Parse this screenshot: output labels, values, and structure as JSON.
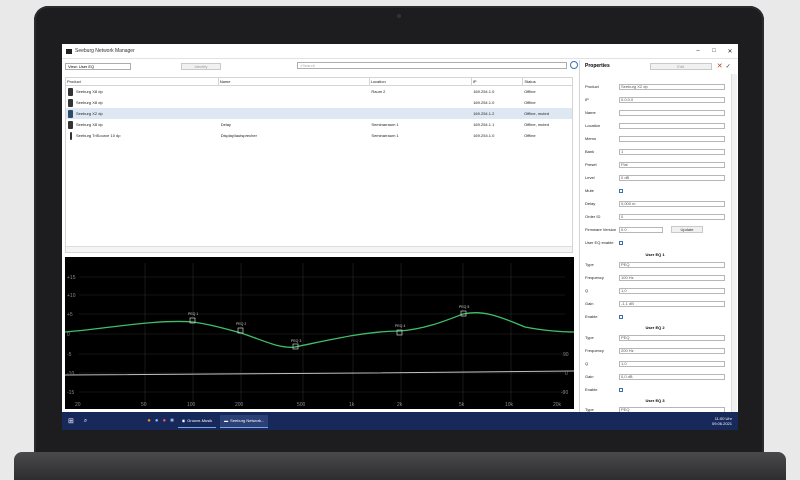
{
  "window": {
    "title": "Seeburg Network Manager",
    "min": "–",
    "max": "□",
    "close": "✕"
  },
  "toolbar": {
    "filter_value": "View: User EQ",
    "identify": "Identify",
    "search_placeholder": "Search"
  },
  "table": {
    "headers": [
      "Product",
      "Name",
      "Location",
      "IP",
      "Status"
    ],
    "rows": [
      {
        "product": "Seeburg X8 dp",
        "name": "",
        "location": "Raum 2",
        "ip": "169.254.1.0",
        "status": "Offline"
      },
      {
        "product": "Seeburg X8 dp",
        "name": "",
        "location": "",
        "ip": "169.254.1.0",
        "status": "Offline"
      },
      {
        "product": "Seeburg X2 dp",
        "name": "",
        "location": "",
        "ip": "169.254.1.2",
        "status": "Offline, muted"
      },
      {
        "product": "Seeburg X8 dp",
        "name": "Delay",
        "location": "Seminarraum 1",
        "ip": "169.254.1.1",
        "status": "Offline, muted"
      },
      {
        "product": "Seeburg TriSource 10 dp",
        "name": "Display/lautsprecher",
        "location": "Seminarraum 1",
        "ip": "169.254.1.0",
        "status": "Offline"
      }
    ]
  },
  "graph": {
    "y_labels": [
      "+15",
      "+10",
      "+5",
      "0",
      "-5",
      "-10",
      "-15"
    ],
    "x_labels": [
      "20",
      "50",
      "100",
      "200",
      "500",
      "1k",
      "2k",
      "5k",
      "10k",
      "20k"
    ],
    "right_labels": [
      "90",
      "0",
      "-90"
    ],
    "points": [
      "PEQ 1",
      "PEQ 2",
      "PEQ 3",
      "PEQ 4",
      "PEQ 5"
    ],
    "colors": {
      "curve": "#3fbf6a",
      "phase": "#bfbfbf",
      "grid": "#2a2a2a"
    }
  },
  "properties": {
    "title": "Properties",
    "edit": "Edit",
    "fields": [
      {
        "label": "Product",
        "value": "Seeburg X2 dp"
      },
      {
        "label": "IP",
        "value": "0.0.0.0"
      },
      {
        "label": "Name",
        "value": ""
      },
      {
        "label": "Location",
        "value": ""
      },
      {
        "label": "Memo",
        "value": ""
      },
      {
        "label": "Bank",
        "value": "1"
      },
      {
        "label": "Preset",
        "value": "Flat"
      },
      {
        "label": "Level",
        "value": "0 dB"
      },
      {
        "label": "Mute",
        "value": ""
      },
      {
        "label": "Delay",
        "value": "0,000 m"
      },
      {
        "label": "Order ID",
        "value": "0"
      },
      {
        "label": "Firmware Version",
        "value": "0.0"
      },
      {
        "label": "User EQ enable",
        "value": ""
      }
    ],
    "update": "Update",
    "eq1": {
      "title": "User EQ 1",
      "type": "PEQ",
      "frequency": "100 Hz",
      "q": "1,0",
      "gain": "-1,1 dB"
    },
    "eq2": {
      "title": "User EQ 2",
      "type": "PEQ",
      "frequency": "200 Hz",
      "q": "1,0",
      "gain": "0,0 dB"
    },
    "eq3": {
      "title": "User EQ 3",
      "type": "PEQ"
    },
    "labels": {
      "type": "Type",
      "frequency": "Frequency",
      "q": "Q",
      "gain": "Gain",
      "enable": "Enable"
    }
  },
  "taskbar": {
    "app1": "Groove-Musik",
    "app2": "Seeburg Network...",
    "time": "11:00 Uhr",
    "date": "09.06.2021"
  }
}
